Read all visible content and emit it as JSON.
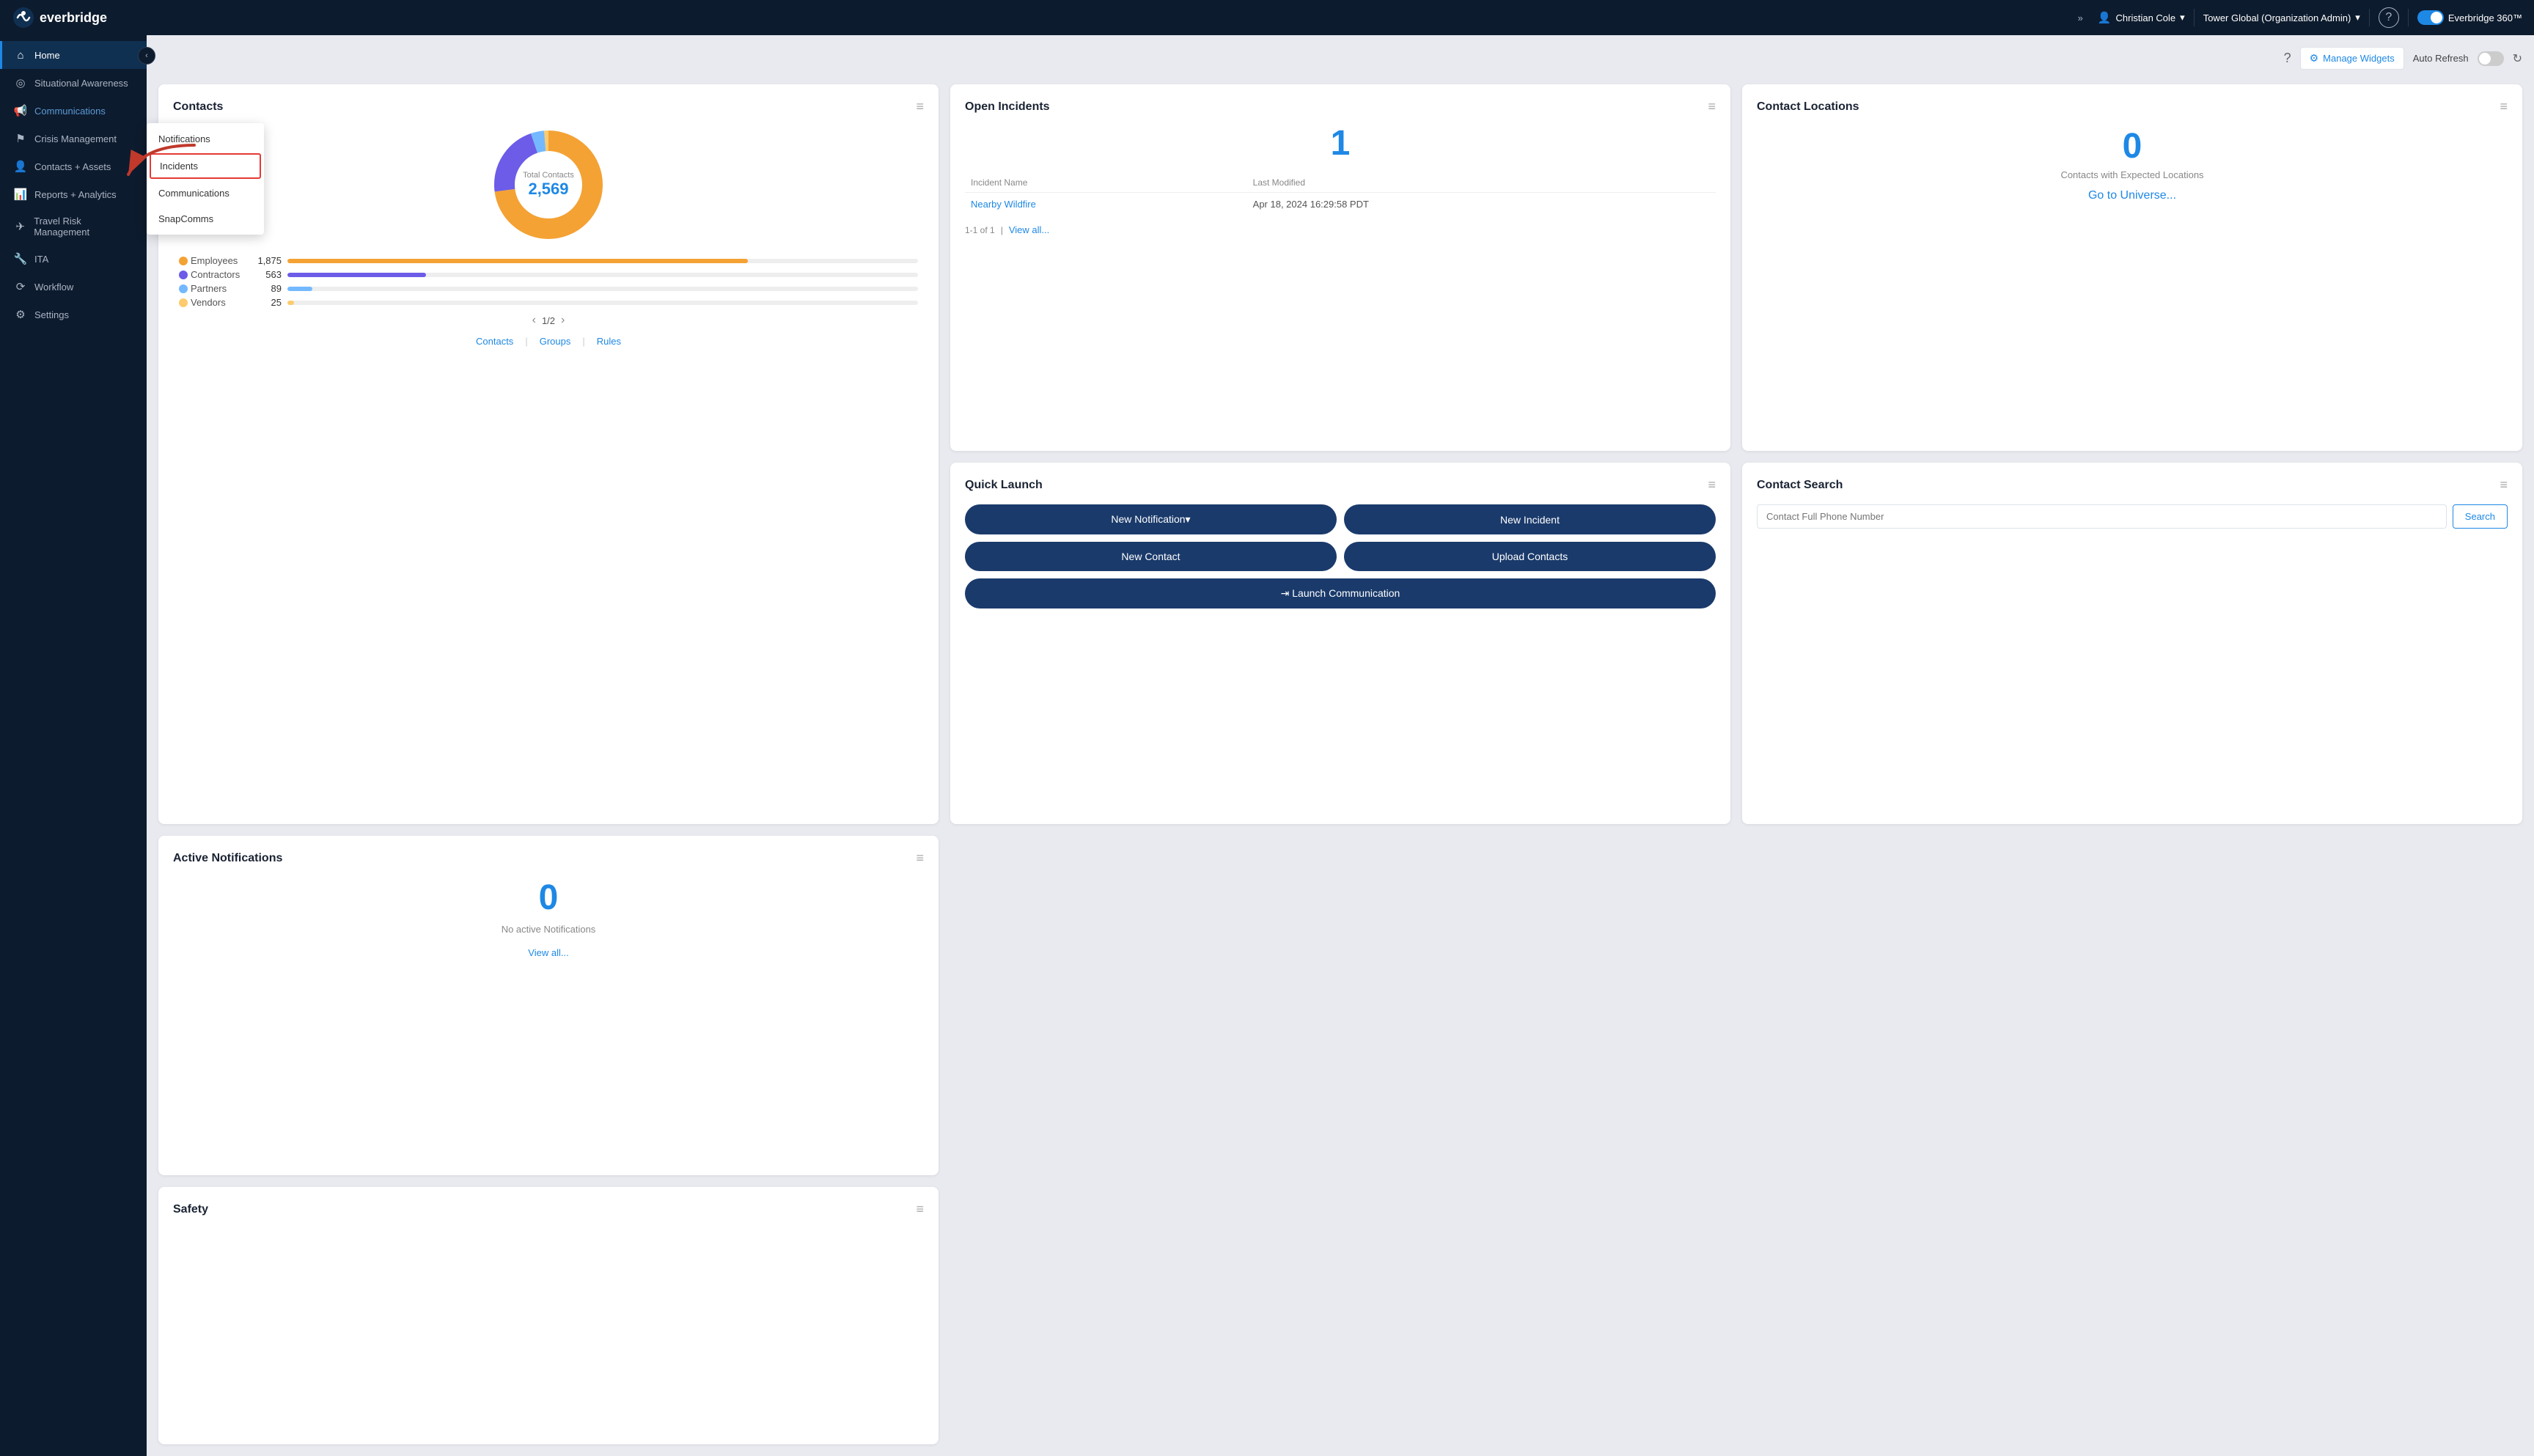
{
  "app": {
    "logo_text": "everbridge",
    "expand_icon": "»"
  },
  "topnav": {
    "user": "Christian Cole",
    "user_dropdown": "▾",
    "org": "Tower Global (Organization Admin)",
    "org_dropdown": "▾",
    "help": "?",
    "product": "Everbridge 360™"
  },
  "sidebar": {
    "collapse_icon": "‹",
    "items": [
      {
        "id": "home",
        "label": "Home",
        "icon": "⌂",
        "active": true
      },
      {
        "id": "situational-awareness",
        "label": "Situational Awareness",
        "icon": "◎",
        "active": false
      },
      {
        "id": "communications",
        "label": "Communications",
        "icon": "📢",
        "active": true,
        "active_parent": true
      },
      {
        "id": "crisis-management",
        "label": "Crisis Management",
        "icon": "⚑",
        "active": false
      },
      {
        "id": "contacts-assets",
        "label": "Contacts + Assets",
        "icon": "👤",
        "active": false
      },
      {
        "id": "reports-analytics",
        "label": "Reports + Analytics",
        "icon": "📊",
        "active": false
      },
      {
        "id": "travel-risk-management",
        "label": "Travel Risk Management",
        "icon": "✈",
        "active": false
      },
      {
        "id": "ita",
        "label": "ITA",
        "icon": "🔧",
        "active": false
      },
      {
        "id": "workflow",
        "label": "Workflow",
        "icon": "⟳",
        "active": false
      },
      {
        "id": "settings",
        "label": "Settings",
        "icon": "⚙",
        "active": false
      }
    ]
  },
  "communications_dropdown": {
    "items": [
      {
        "id": "notifications",
        "label": "Notifications",
        "highlighted": false
      },
      {
        "id": "incidents",
        "label": "Incidents",
        "highlighted": true
      },
      {
        "id": "communications",
        "label": "Communications",
        "highlighted": false
      },
      {
        "id": "snapcomms",
        "label": "SnapComms",
        "highlighted": false
      }
    ]
  },
  "header": {
    "manage_widgets": "Manage Widgets",
    "auto_refresh": "Auto Refresh",
    "help_icon": "?",
    "refresh_icon": "↻"
  },
  "contacts_card": {
    "title": "Contacts",
    "menu": "≡",
    "total_label": "Total Contacts",
    "total": "2,569",
    "segments": [
      {
        "name": "Employees",
        "count": 1875,
        "color": "#f4a234",
        "bar_pct": 73
      },
      {
        "name": "Contractors",
        "count": 563,
        "color": "#6c5ce7",
        "bar_pct": 22
      },
      {
        "name": "Partners",
        "count": 89,
        "color": "#74b9ff",
        "bar_pct": 4
      },
      {
        "name": "Vendors",
        "count": 25,
        "color": "#fdcb6e",
        "bar_pct": 1
      }
    ],
    "page_current": 1,
    "page_total": 2,
    "prev_icon": "‹",
    "next_icon": "›",
    "links": [
      {
        "label": "Contacts"
      },
      {
        "label": "Groups"
      },
      {
        "label": "Rules"
      }
    ]
  },
  "open_incidents_card": {
    "title": "Open Incidents",
    "menu": "≡",
    "count": "1",
    "table_headers": [
      "Incident Name",
      "Last Modified"
    ],
    "rows": [
      {
        "name": "Nearby Wildfire",
        "modified": "Apr 18, 2024 16:29:58 PDT"
      }
    ],
    "pagination_label": "1-1 of 1",
    "separator": "|",
    "view_all": "View all..."
  },
  "quick_launch_card": {
    "title": "Quick Launch",
    "menu": "≡",
    "buttons": [
      {
        "id": "new-notification",
        "label": "New Notification▾",
        "wide": false
      },
      {
        "id": "new-incident",
        "label": "New Incident",
        "wide": false
      },
      {
        "id": "new-contact",
        "label": "New Contact",
        "wide": false
      },
      {
        "id": "upload-contacts",
        "label": "Upload Contacts",
        "wide": false
      },
      {
        "id": "launch-communication",
        "label": "⇥ Launch Communication",
        "wide": true
      }
    ]
  },
  "active_notifications_card": {
    "title": "Active Notifications",
    "menu": "≡",
    "count": "0",
    "empty_label": "No active Notifications",
    "view_all": "View all..."
  },
  "contact_locations_card": {
    "title": "Contact Locations",
    "menu": "≡",
    "count": "0",
    "label": "Contacts with Expected Locations",
    "link": "Go to Universe..."
  },
  "contact_search_card": {
    "title": "Contact Search",
    "menu": "≡",
    "placeholder": "Contact Full Phone Number",
    "search_btn": "Search"
  },
  "safety_card": {
    "title": "Safety",
    "menu": "≡"
  },
  "colors": {
    "sidebar_bg": "#0d1b2e",
    "brand_blue": "#1e88e5",
    "accent_orange": "#f4a234",
    "accent_purple": "#6c5ce7",
    "accent_light_blue": "#74b9ff",
    "accent_yellow": "#fdcb6e",
    "button_dark": "#1a3a6b"
  }
}
